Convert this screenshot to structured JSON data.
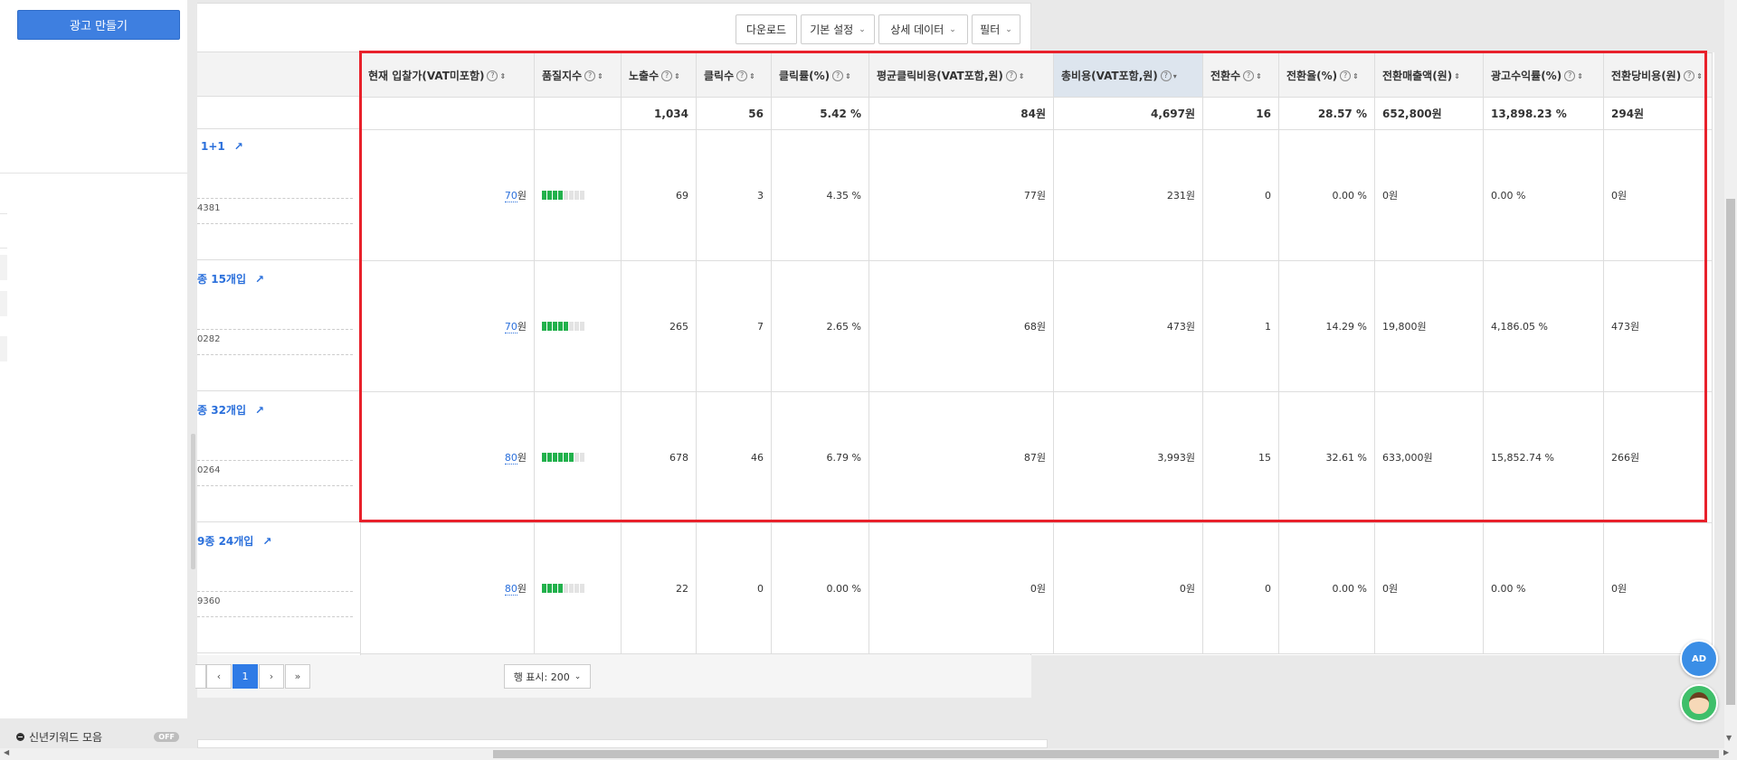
{
  "sidebar": {
    "create_ad_label": "광고 만들기",
    "new_keyword_label": "신년키워드 모음",
    "new_keyword_toggle": "OFF"
  },
  "toolbar": {
    "download_label": "다운로드",
    "basic_settings_label": "기본 설정",
    "detail_data_label": "상세 데이터",
    "filter_label": "필터"
  },
  "table": {
    "columns": [
      "현재 입찰가(VAT미포함)",
      "품질지수",
      "노출수",
      "클릭수",
      "클릭률(%)",
      "평균클릭비용(VAT포함,원)",
      "총비용(VAT포함,원)",
      "전환수",
      "전환율(%)",
      "전환매출액(원)",
      "광고수익률(%)",
      "전환당비용(원)"
    ],
    "totals": [
      "",
      "",
      "1,034",
      "56",
      "5.42 %",
      "84원",
      "4,697원",
      "16",
      "28.57 %",
      "652,800원",
      "13,898.23 %",
      "294원"
    ],
    "rows": [
      {
        "product_name": "1+1",
        "product_id": "4381",
        "bid_value": "70",
        "bid_unit": "원",
        "quality_level": 4,
        "cells": [
          "69",
          "3",
          "4.35 %",
          "77원",
          "231원",
          "0",
          "0.00 %",
          "0원",
          "0.00 %",
          "0원"
        ]
      },
      {
        "product_name": "종 15개입",
        "product_id": "0282",
        "bid_value": "70",
        "bid_unit": "원",
        "quality_level": 5,
        "cells": [
          "265",
          "7",
          "2.65 %",
          "68원",
          "473원",
          "1",
          "14.29 %",
          "19,800원",
          "4,186.05 %",
          "473원"
        ]
      },
      {
        "product_name": "종 32개입",
        "product_id": "0264",
        "bid_value": "80",
        "bid_unit": "원",
        "quality_level": 6,
        "cells": [
          "678",
          "46",
          "6.79 %",
          "87원",
          "3,993원",
          "15",
          "32.61 %",
          "633,000원",
          "15,852.74 %",
          "266원"
        ]
      },
      {
        "product_name": "9종 24개입",
        "product_id": "9360",
        "bid_value": "80",
        "bid_unit": "원",
        "quality_level": 4,
        "cells": [
          "22",
          "0",
          "0.00 %",
          "0원",
          "0원",
          "0",
          "0.00 %",
          "0원",
          "0.00 %",
          "0원"
        ]
      }
    ]
  },
  "pagination": {
    "prev_label": "‹",
    "current_page": "1",
    "next_label": "›",
    "last_label": "»",
    "rows_label": "행 표시: 200"
  },
  "fab": {
    "ad_label": "AD"
  },
  "colors": {
    "accent": "#3e7fe0",
    "highlight": "#e8212b",
    "quality_on": "#22b14c"
  }
}
